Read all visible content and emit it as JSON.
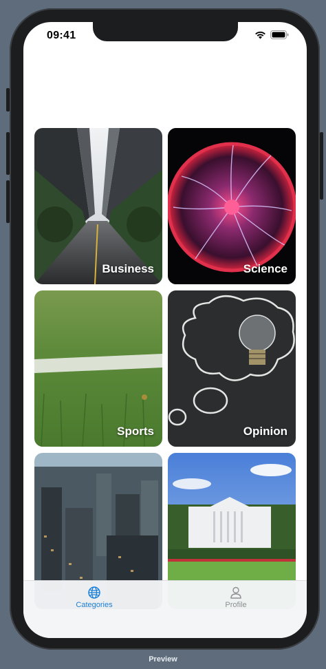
{
  "status_bar": {
    "time": "09:41"
  },
  "categories": [
    {
      "label": "Business"
    },
    {
      "label": "Science"
    },
    {
      "label": "Sports"
    },
    {
      "label": "Opinion"
    },
    {
      "label": ""
    },
    {
      "label": ""
    }
  ],
  "tab_bar": {
    "categories": {
      "label": "Categories",
      "icon": "globe-icon",
      "active": true,
      "color": "#1a7fd6"
    },
    "profile": {
      "label": "Profile",
      "icon": "person-icon",
      "active": false,
      "color": "#8e8e93"
    }
  },
  "footer": {
    "label": "Preview"
  }
}
